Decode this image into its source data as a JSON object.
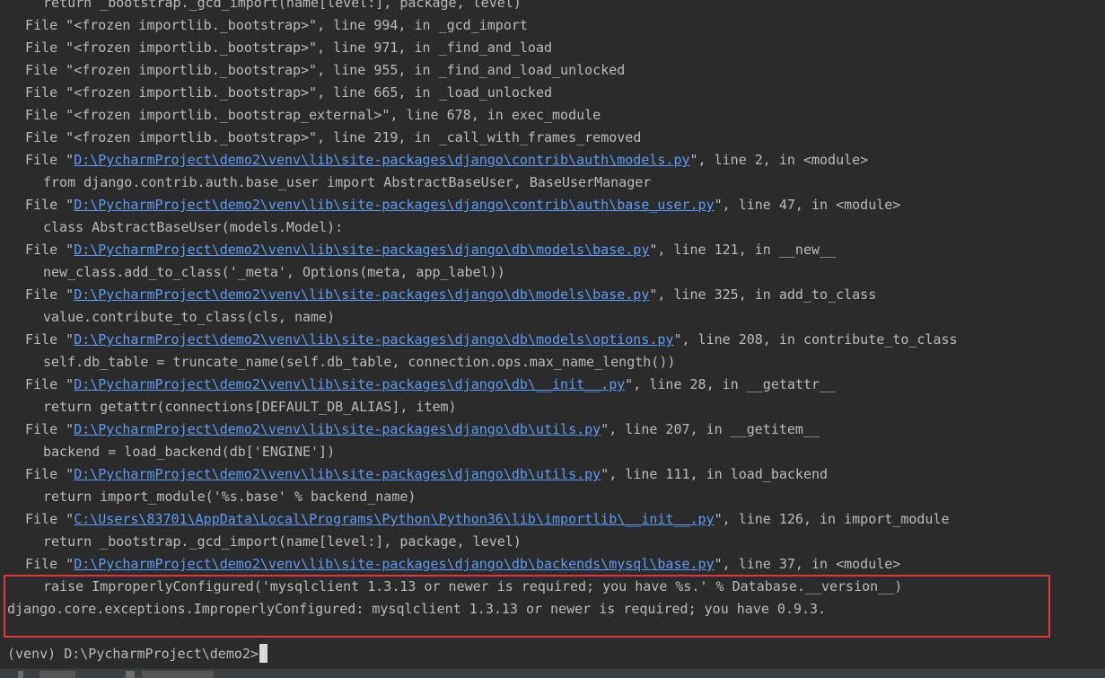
{
  "traceback": [
    {
      "indent": 2,
      "text": "return _bootstrap._gcd_import(name[level:], package, level)"
    },
    {
      "indent": 1,
      "pre": "File \"",
      "path": "<frozen importlib._bootstrap>",
      "post": "\", line 994, in _gcd_import",
      "link": false
    },
    {
      "indent": 1,
      "pre": "File \"",
      "path": "<frozen importlib._bootstrap>",
      "post": "\", line 971, in _find_and_load",
      "link": false
    },
    {
      "indent": 1,
      "pre": "File \"",
      "path": "<frozen importlib._bootstrap>",
      "post": "\", line 955, in _find_and_load_unlocked",
      "link": false
    },
    {
      "indent": 1,
      "pre": "File \"",
      "path": "<frozen importlib._bootstrap>",
      "post": "\", line 665, in _load_unlocked",
      "link": false
    },
    {
      "indent": 1,
      "pre": "File \"",
      "path": "<frozen importlib._bootstrap_external>",
      "post": "\", line 678, in exec_module",
      "link": false
    },
    {
      "indent": 1,
      "pre": "File \"",
      "path": "<frozen importlib._bootstrap>",
      "post": "\", line 219, in _call_with_frames_removed",
      "link": false
    },
    {
      "indent": 1,
      "pre": "File \"",
      "path": "D:\\PycharmProject\\demo2\\venv\\lib\\site-packages\\django\\contrib\\auth\\models.py",
      "post": "\", line 2, in <module>",
      "link": true
    },
    {
      "indent": 2,
      "text": "from django.contrib.auth.base_user import AbstractBaseUser, BaseUserManager"
    },
    {
      "indent": 1,
      "pre": "File \"",
      "path": "D:\\PycharmProject\\demo2\\venv\\lib\\site-packages\\django\\contrib\\auth\\base_user.py",
      "post": "\", line 47, in <module>",
      "link": true
    },
    {
      "indent": 2,
      "text": "class AbstractBaseUser(models.Model):"
    },
    {
      "indent": 1,
      "pre": "File \"",
      "path": "D:\\PycharmProject\\demo2\\venv\\lib\\site-packages\\django\\db\\models\\base.py",
      "post": "\", line 121, in __new__",
      "link": true
    },
    {
      "indent": 2,
      "text": "new_class.add_to_class('_meta', Options(meta, app_label))"
    },
    {
      "indent": 1,
      "pre": "File \"",
      "path": "D:\\PycharmProject\\demo2\\venv\\lib\\site-packages\\django\\db\\models\\base.py",
      "post": "\", line 325, in add_to_class",
      "link": true
    },
    {
      "indent": 2,
      "text": "value.contribute_to_class(cls, name)"
    },
    {
      "indent": 1,
      "pre": "File \"",
      "path": "D:\\PycharmProject\\demo2\\venv\\lib\\site-packages\\django\\db\\models\\options.py",
      "post": "\", line 208, in contribute_to_class",
      "link": true
    },
    {
      "indent": 2,
      "text": "self.db_table = truncate_name(self.db_table, connection.ops.max_name_length())"
    },
    {
      "indent": 1,
      "pre": "File \"",
      "path": "D:\\PycharmProject\\demo2\\venv\\lib\\site-packages\\django\\db\\__init__.py",
      "post": "\", line 28, in __getattr__",
      "link": true
    },
    {
      "indent": 2,
      "text": "return getattr(connections[DEFAULT_DB_ALIAS], item)"
    },
    {
      "indent": 1,
      "pre": "File \"",
      "path": "D:\\PycharmProject\\demo2\\venv\\lib\\site-packages\\django\\db\\utils.py",
      "post": "\", line 207, in __getitem__",
      "link": true
    },
    {
      "indent": 2,
      "text": "backend = load_backend(db['ENGINE'])"
    },
    {
      "indent": 1,
      "pre": "File \"",
      "path": "D:\\PycharmProject\\demo2\\venv\\lib\\site-packages\\django\\db\\utils.py",
      "post": "\", line 111, in load_backend",
      "link": true
    },
    {
      "indent": 2,
      "text": "return import_module('%s.base' % backend_name)"
    },
    {
      "indent": 1,
      "pre": "File \"",
      "path": "C:\\Users\\83701\\AppData\\Local\\Programs\\Python\\Python36\\lib\\importlib\\__init__.py",
      "post": "\", line 126, in import_module",
      "link": true
    },
    {
      "indent": 2,
      "text": "return _bootstrap._gcd_import(name[level:], package, level)"
    },
    {
      "indent": 1,
      "pre": "File \"",
      "path": "D:\\PycharmProject\\demo2\\venv\\lib\\site-packages\\django\\db\\backends\\mysql\\base.py",
      "post": "\", line 37, in <module>",
      "link": true
    },
    {
      "indent": 2,
      "text": "raise ImproperlyConfigured('mysqlclient 1.3.13 or newer is required; you have %s.' % Database.__version__)"
    },
    {
      "indent": 0,
      "text": "django.core.exceptions.ImproperlyConfigured: mysqlclient 1.3.13 or newer is required; you have 0.9.3."
    },
    {
      "indent": 0,
      "text": ""
    }
  ],
  "prompt": "(venv) D:\\PycharmProject\\demo2>",
  "colors": {
    "background": "#2b2b2b",
    "text": "#bbbbbb",
    "link": "#5a9cf8",
    "highlight_box": "#e3363a"
  }
}
